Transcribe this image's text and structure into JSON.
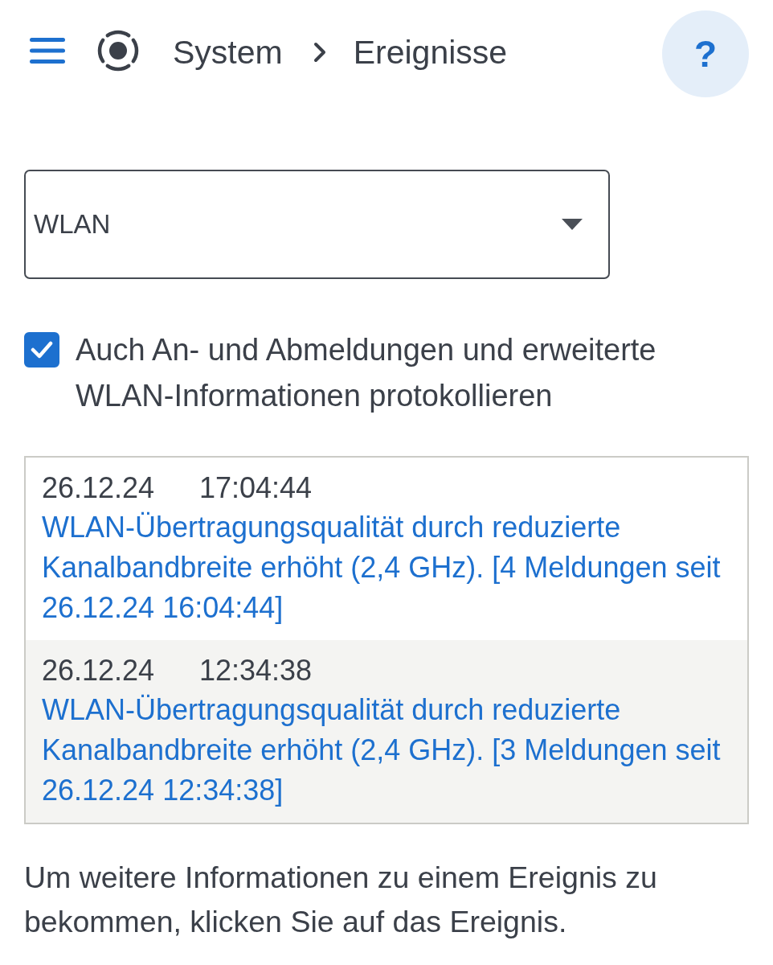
{
  "header": {
    "breadcrumb": [
      {
        "label": "System"
      },
      {
        "label": "Ereignisse"
      }
    ],
    "help_button": {
      "label": "?"
    }
  },
  "filter": {
    "value": "WLAN"
  },
  "option": {
    "label": "Auch An- und Abmeldungen und erweiterte WLAN-Informationen protokollieren",
    "checked": true
  },
  "events": [
    {
      "date": "26.12.24",
      "time": "17:04:44",
      "message": "WLAN-Übertragungsqualität durch reduzierte Kanalbandbreite erhöht (2,4 GHz). [4 Meldungen seit 26.12.24 16:04:44]"
    },
    {
      "date": "26.12.24",
      "time": "12:34:38",
      "message": "WLAN-Übertragungsqualität durch reduzierte Kanalbandbreite erhöht (2,4 GHz). [3 Meldungen seit 26.12.24 12:34:38]"
    }
  ],
  "hint": "Um weitere Informationen zu einem Ereignis zu bekommen, klicken Sie auf das Ereignis."
}
